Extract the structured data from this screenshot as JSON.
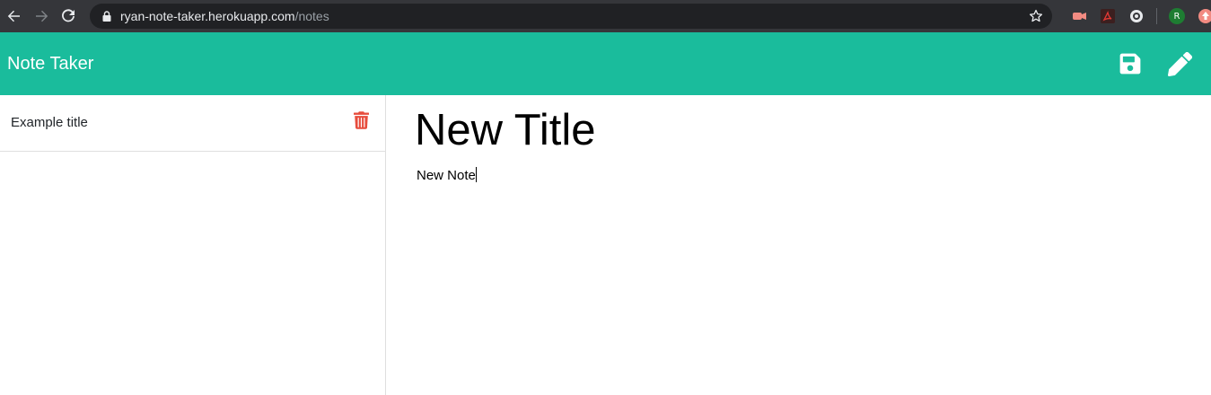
{
  "browser": {
    "url_host": "ryan-note-taker.herokuapp.com",
    "url_path": "/notes",
    "profile_initial": "R",
    "icons": [
      "back-arrow-icon",
      "forward-arrow-icon",
      "reload-icon",
      "lock-icon",
      "star-icon",
      "extension-icon",
      "pdf-extension-icon",
      "extension-icon",
      "profile-avatar",
      "extension-icon"
    ]
  },
  "header": {
    "brand": "Note Taker",
    "background": "#1abc9c",
    "save_icon": "save-icon",
    "edit_icon": "pencil-icon"
  },
  "sidebar": {
    "notes": [
      {
        "title": "Example title",
        "delete_icon": "trash-icon",
        "delete_color": "#e74c3c"
      }
    ]
  },
  "editor": {
    "title": "New Title",
    "text": "New Note"
  }
}
